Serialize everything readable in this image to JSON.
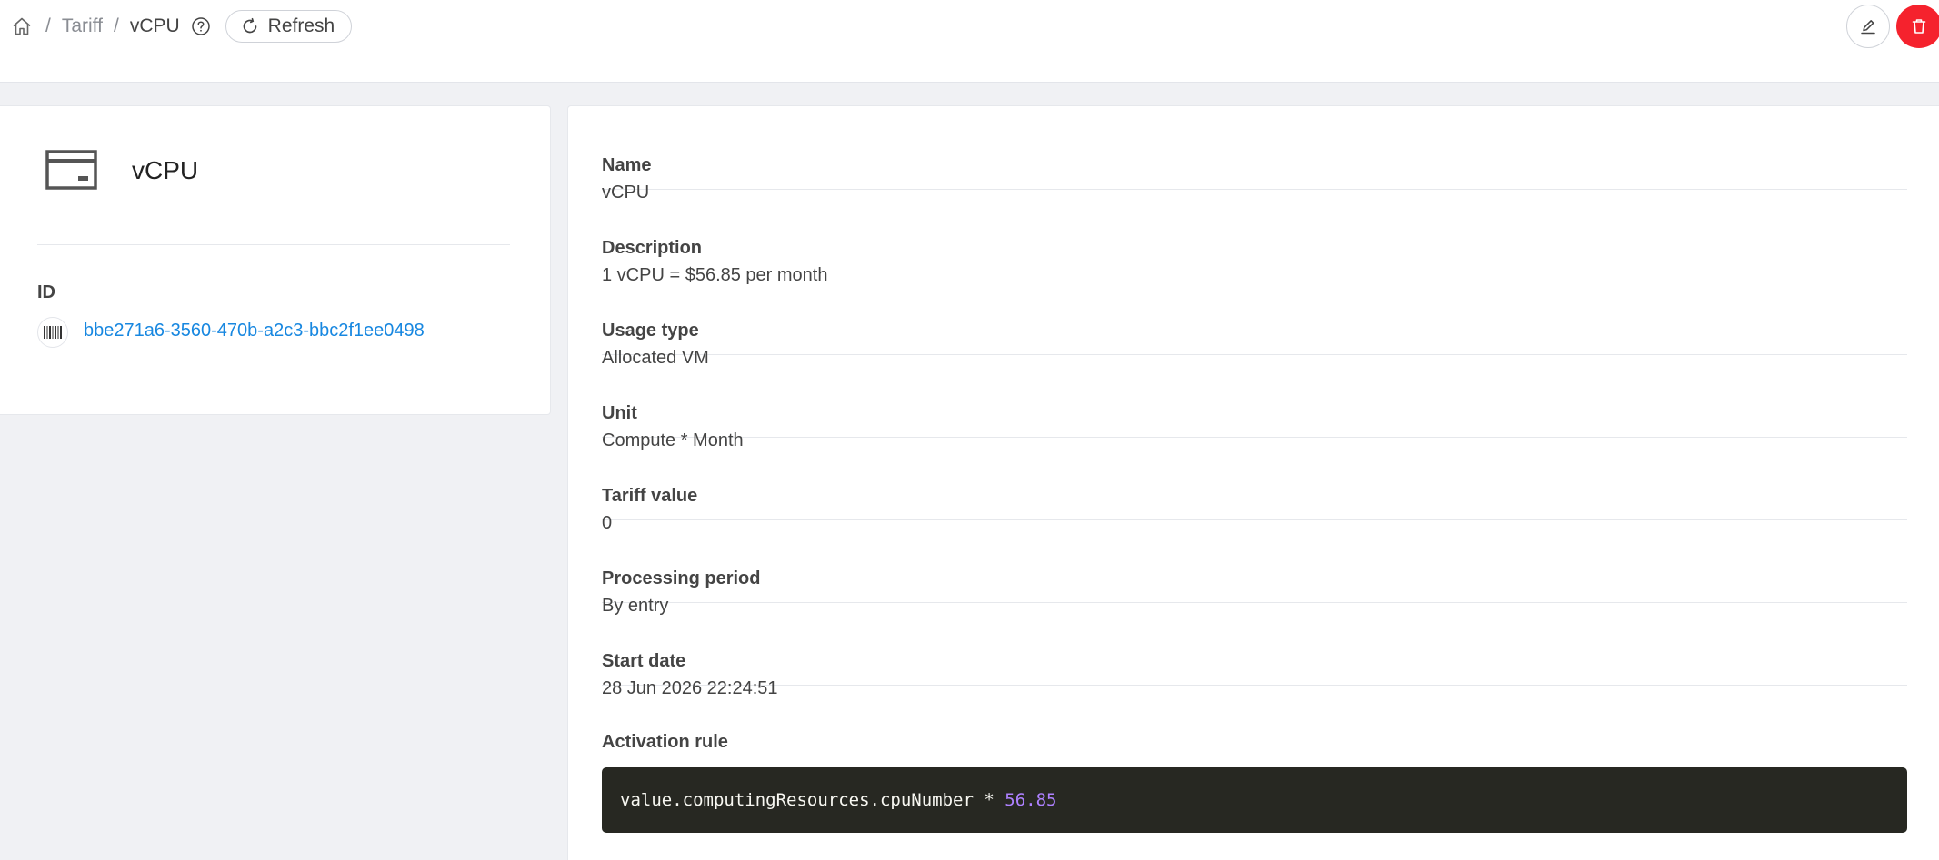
{
  "breadcrumb": {
    "items": [
      {
        "label": "Tariff"
      },
      {
        "label": "vCPU"
      }
    ],
    "separator": "/",
    "refresh_label": "Refresh"
  },
  "summary": {
    "title": "vCPU",
    "id_label": "ID",
    "id_value": "bbe271a6-3560-470b-a2c3-bbc2f1ee0498"
  },
  "details": {
    "fields": [
      {
        "label": "Name",
        "value": "vCPU"
      },
      {
        "label": "Description",
        "value": "1 vCPU = $56.85 per month"
      },
      {
        "label": "Usage type",
        "value": "Allocated VM"
      },
      {
        "label": "Unit",
        "value": "Compute * Month"
      },
      {
        "label": "Tariff value",
        "value": "0"
      },
      {
        "label": "Processing period",
        "value": "By entry"
      },
      {
        "label": "Start date",
        "value": "28 Jun 2026 22:24:51"
      }
    ],
    "activation_rule_label": "Activation rule",
    "activation_rule": {
      "expression": "value.computingResources.cpuNumber * ",
      "number": "56.85"
    }
  },
  "colors": {
    "accent_link": "#1787e0",
    "danger": "#f5222d",
    "code_bg": "#272822",
    "code_number": "#ae81ff"
  },
  "icons": [
    "home-icon",
    "help-icon",
    "refresh-icon",
    "edit-icon",
    "trash-icon",
    "card-icon",
    "barcode-icon"
  ]
}
